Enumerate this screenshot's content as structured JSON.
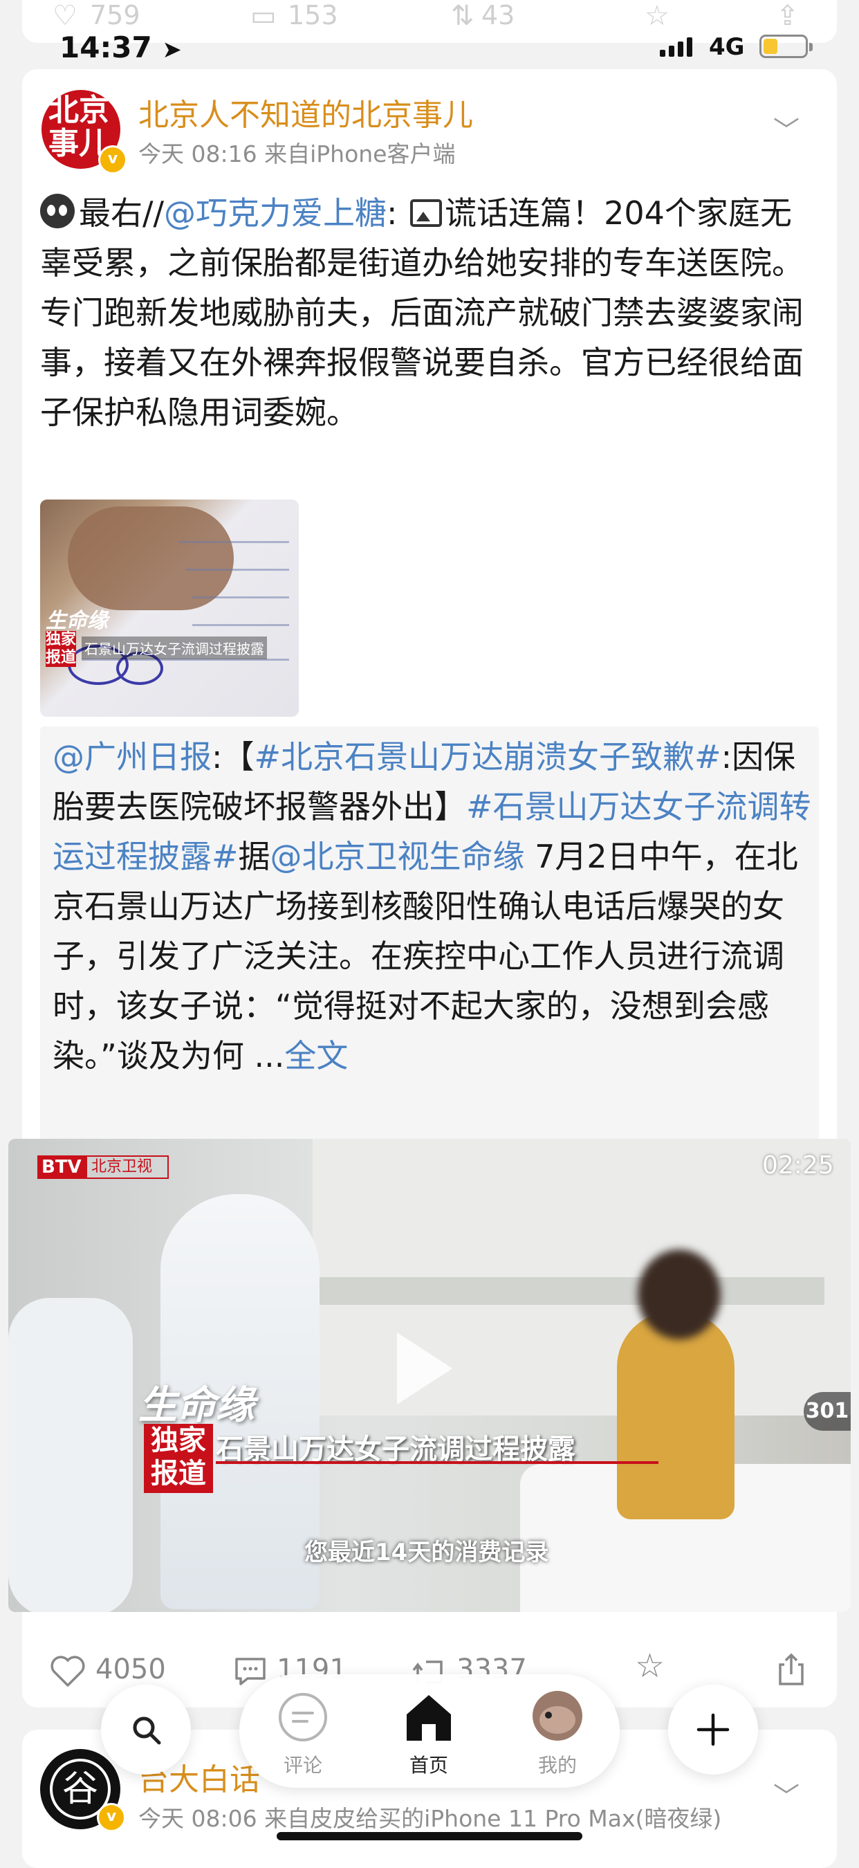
{
  "status_bar": {
    "time": "14:37",
    "network": "4G"
  },
  "prev_post_actions": {
    "likes": "759",
    "comments": "153",
    "reposts": "43"
  },
  "post": {
    "author": "北京人不知道的北京事儿",
    "avatar_text": "北京事儿",
    "meta": "今天 08:16  来自iPhone客户端",
    "text_prefix": "最右//",
    "mention": "@巧克力爱上糖",
    "text_after_mention": ": ",
    "text_body": "谎话连篇！204个家庭无辜受累，之前保胎都是街道办给她安排的专车送医院。专门跑新发地威胁前夫，后面流产就破门禁去婆婆家闹事，接着又在外裸奔报假警说要自杀。官方已经很给面子保护私隐用词委婉。",
    "thumb": {
      "logo": "生命缘",
      "label": "独家报道",
      "caption": "石景山万达女子流调过程披露"
    },
    "repost": {
      "source": "@广州日报",
      "p1": ":【",
      "tag1": "#北京石景山万达崩溃女子致歉#",
      "p2": ":因保胎要去医院破坏报警器外出】",
      "tag2": "#石景山万达女子流调转运过程披露#",
      "p3": "据",
      "mention2": "@北京卫视生命缘",
      "p4": " 7月2日中午，在北京石景山万达广场接到核酸阳性确认电话后爆哭的女子，引发了广泛关注。在疾控中心工作人员进行流调时，该女子说：“觉得挺对不起大家的，没想到会感染。”谈及为何 ...",
      "more": "全文"
    },
    "video": {
      "channel": "BTV",
      "channel2": "北京卫视",
      "duration": "02:25",
      "logo": "生命缘",
      "exclusive": "独家报道",
      "caption": "石景山万达女子流调过程披露",
      "subtitle": "您最近14天的消费记录",
      "count": "301"
    },
    "actions": {
      "likes": "4050",
      "comments": "1191",
      "reposts": "3337"
    }
  },
  "tabbar": {
    "comment": "评论",
    "home": "首页",
    "me": "我的"
  },
  "next_post": {
    "author": "台大白话",
    "meta": "今天 08:06  来自皮皮给买的iPhone 11 Pro Max(暗夜绿)"
  },
  "colors": {
    "accent_blue": "#4b82c3",
    "author_gold": "#d88e1c",
    "brand_red": "#c8101a"
  }
}
